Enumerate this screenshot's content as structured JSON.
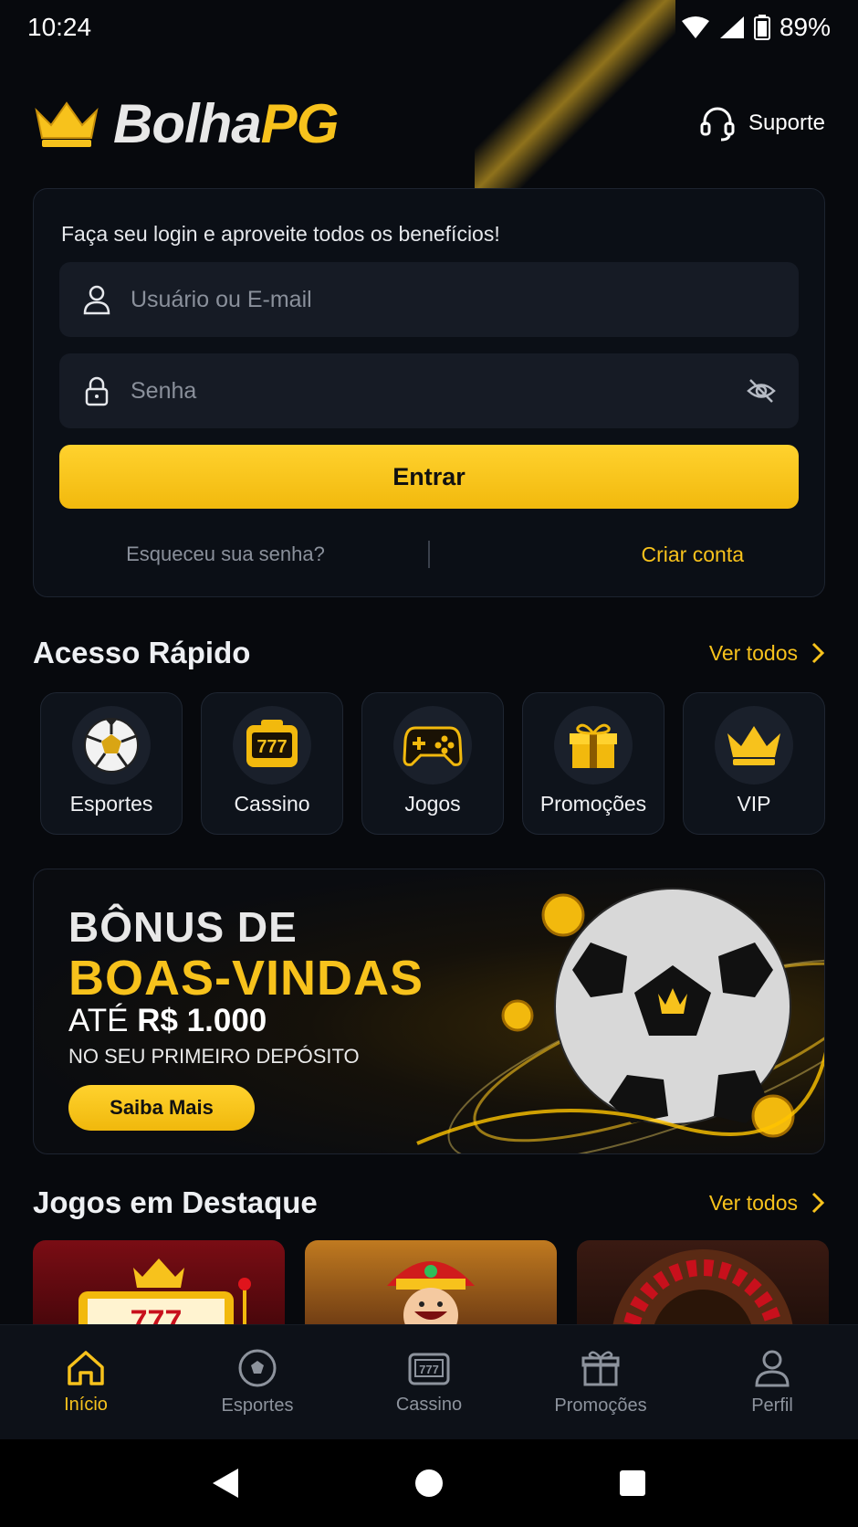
{
  "status_bar": {
    "time": "10:24",
    "battery": "89%"
  },
  "header": {
    "logo_part1": "Bolha",
    "logo_part2": "PG",
    "support_label": "Suporte"
  },
  "login": {
    "intro": "Faça seu login e aproveite todos os benefícios!",
    "user_placeholder": "Usuário ou E-mail",
    "password_placeholder": "Senha",
    "submit_label": "Entrar",
    "forgot_label": "Esqueceu sua senha?",
    "create_label": "Criar conta"
  },
  "quick_access": {
    "title": "Acesso Rápido",
    "see_all": "Ver todos",
    "items": [
      {
        "label": "Esportes",
        "icon": "soccer-ball-icon"
      },
      {
        "label": "Cassino",
        "icon": "slot-machine-icon"
      },
      {
        "label": "Jogos",
        "icon": "gamepad-icon"
      },
      {
        "label": "Promoções",
        "icon": "gift-icon"
      },
      {
        "label": "VIP",
        "icon": "crown-icon"
      }
    ]
  },
  "banner": {
    "line1": "BÔNUS DE",
    "line2": "BOAS-VINDAS",
    "line3_prefix": "ATÉ",
    "line3_amount": "R$ 1.000",
    "line4": "NO SEU PRIMEIRO DEPÓSITO",
    "button": "Saiba Mais"
  },
  "featured": {
    "title": "Jogos em Destaque",
    "see_all": "Ver todos"
  },
  "bottom_nav": [
    {
      "label": "Início",
      "icon": "home-icon",
      "active": true
    },
    {
      "label": "Esportes",
      "icon": "soccer-ball-icon",
      "active": false
    },
    {
      "label": "Cassino",
      "icon": "slot-machine-icon",
      "active": false
    },
    {
      "label": "Promoções",
      "icon": "gift-icon",
      "active": false
    },
    {
      "label": "Perfil",
      "icon": "user-icon",
      "active": false
    }
  ],
  "colors": {
    "accent": "#f7c21c",
    "background": "#07090d",
    "card": "#0b0f16"
  }
}
